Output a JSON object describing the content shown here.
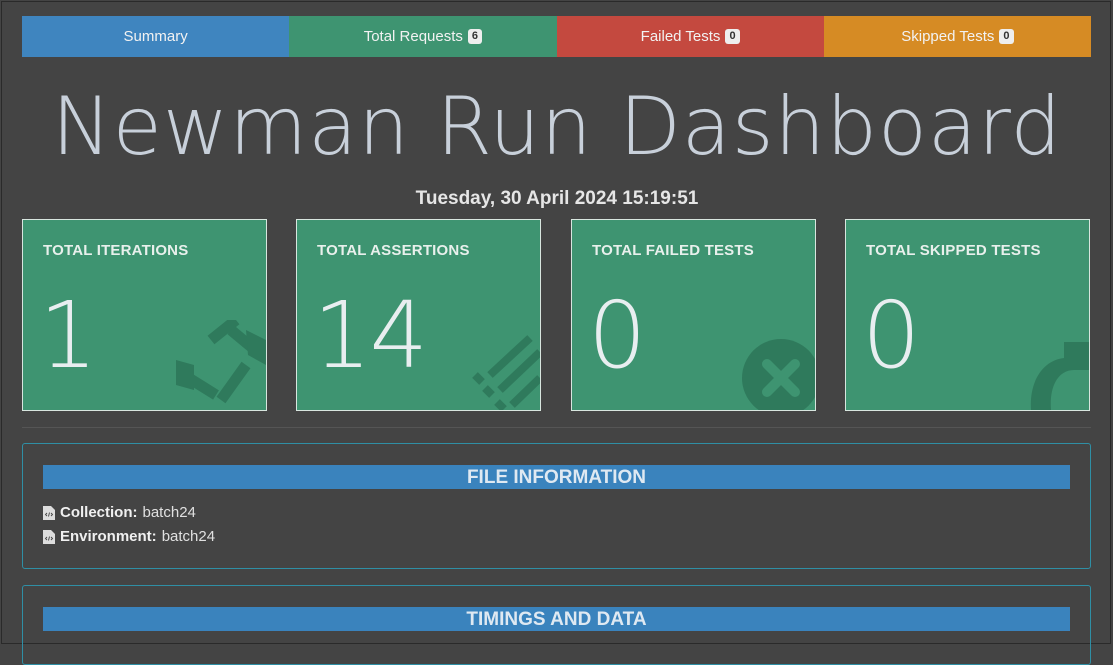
{
  "tabs": [
    {
      "label": "Summary",
      "color": "#3f85bf"
    },
    {
      "label": "Total Requests",
      "badge": "6",
      "color": "#3e9471"
    },
    {
      "label": "Failed Tests",
      "badge": "0",
      "color": "#c4493f"
    },
    {
      "label": "Skipped Tests",
      "badge": "0",
      "color": "#d68b24"
    }
  ],
  "title": "Newman Run Dashboard",
  "date": "Tuesday, 30 April 2024 15:19:51",
  "cards": [
    {
      "label": "TOTAL ITERATIONS",
      "value": "1",
      "icon": "sync-icon"
    },
    {
      "label": "TOTAL ASSERTIONS",
      "value": "14",
      "icon": "list-icon"
    },
    {
      "label": "TOTAL FAILED TESTS",
      "value": "0",
      "icon": "times-circle-icon"
    },
    {
      "label": "TOTAL SKIPPED TESTS",
      "value": "0",
      "icon": "share-icon"
    }
  ],
  "file_info": {
    "header": "FILE INFORMATION",
    "collection_label": "Collection:",
    "collection_value": "batch24",
    "environment_label": "Environment:",
    "environment_value": "batch24"
  },
  "timings": {
    "header": "TIMINGS AND DATA"
  }
}
